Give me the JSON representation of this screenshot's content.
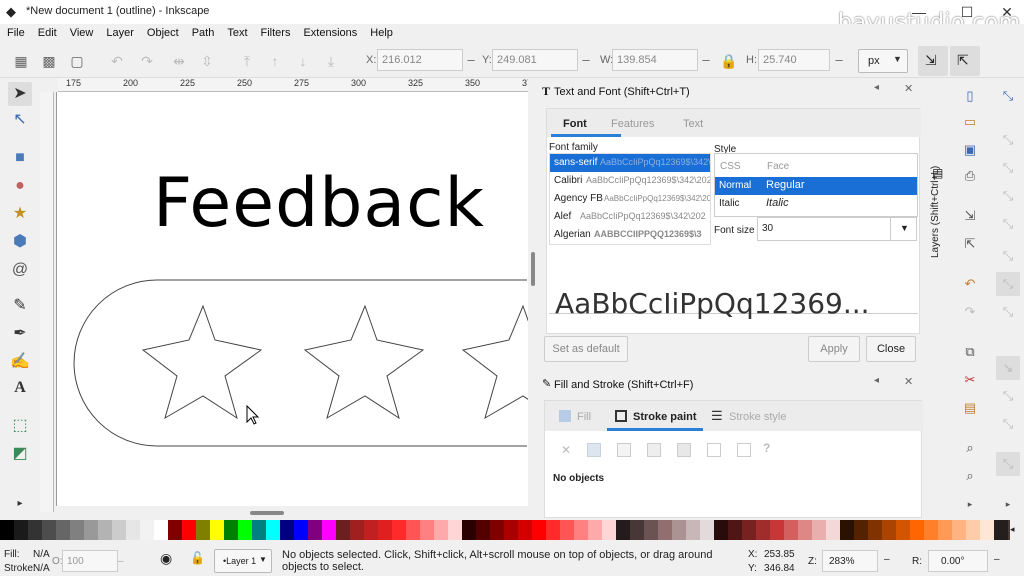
{
  "window": {
    "title": "*New document 1 (outline) - Inkscape"
  },
  "watermark": "bayustudio.com",
  "menu": [
    "File",
    "Edit",
    "View",
    "Layer",
    "Object",
    "Path",
    "Text",
    "Filters",
    "Extensions",
    "Help"
  ],
  "toolbar": {
    "x_label": "X:",
    "x_value": "216.012",
    "y_label": "Y:",
    "y_value": "249.081",
    "w_label": "W:",
    "w_value": "139.854",
    "h_label": "H:",
    "h_value": "25.740",
    "unit": "px"
  },
  "ruler": {
    "top_ticks": [
      "175",
      "200",
      "225",
      "250",
      "275",
      "300",
      "325",
      "350",
      "375",
      "400"
    ]
  },
  "canvas": {
    "text": "Feedback"
  },
  "text_font_panel": {
    "title": "Text and Font (Shift+Ctrl+T)",
    "tabs": [
      "Font",
      "Features",
      "Text"
    ],
    "font_family_label": "Font family",
    "families": [
      {
        "name": "sans-serif",
        "sample": "AaBbCcIiPpQq12369$\\342\\202\\"
      },
      {
        "name": "Calibri",
        "sample": "AaBbCcIiPpQq12369$\\342\\202"
      },
      {
        "name": "Agency FB",
        "sample": "AaBbCcIiPpQq12369$\\342\\202\\25"
      },
      {
        "name": "Alef",
        "sample": "AaBbCcIiPpQq12369$\\342\\202"
      },
      {
        "name": "Algerian",
        "sample": "AABBCCIIPPQQ12369$\\3"
      }
    ],
    "style_label": "Style",
    "style_headers": [
      "CSS",
      "Face"
    ],
    "styles": [
      {
        "css": "Normal",
        "face": "Regular"
      },
      {
        "css": "Italic",
        "face": "Italic"
      }
    ],
    "font_size_label": "Font size",
    "font_size": "30",
    "preview": "AaBbCcIiPpQq12369...",
    "set_default": "Set as default",
    "apply": "Apply",
    "close": "Close"
  },
  "fill_stroke_panel": {
    "title": "Fill and Stroke (Shift+Ctrl+F)",
    "tabs": [
      "Fill",
      "Stroke paint",
      "Stroke style"
    ],
    "no_objects": "No objects"
  },
  "right_panel_label": "Layers (Shift+Ctrl+L)",
  "palette": [
    "#000000",
    "#1a1a1a",
    "#333333",
    "#4d4d4d",
    "#666666",
    "#808080",
    "#999999",
    "#b3b3b3",
    "#cccccc",
    "#e6e6e6",
    "#f2f2f2",
    "#ffffff",
    "#800000",
    "#ff0000",
    "#808000",
    "#ffff00",
    "#008000",
    "#00ff00",
    "#008080",
    "#00ffff",
    "#000080",
    "#0000ff",
    "#800080",
    "#ff00ff",
    "#6b1f1f",
    "#a02020",
    "#c02020",
    "#e02020",
    "#ff2a2a",
    "#ff5555",
    "#ff8080",
    "#ffaaaa",
    "#ffd5d5",
    "#2b0000",
    "#550000",
    "#800000",
    "#aa0000",
    "#d40000",
    "#ff0000",
    "#ff2a2a",
    "#ff5555",
    "#ff8080",
    "#ffaaaa",
    "#ffd5d5",
    "#241c1c",
    "#483737",
    "#6c5353",
    "#916f6f",
    "#ac9393",
    "#c8b7b7",
    "#e3dbdb",
    "#280b0b",
    "#501616",
    "#782121",
    "#a02c2c",
    "#c83737",
    "#d35f5f",
    "#de8787",
    "#e9afaf",
    "#f4d7d7",
    "#2b1100",
    "#552200",
    "#803300",
    "#aa4400",
    "#d45500",
    "#ff6600",
    "#ff7f2a",
    "#ff9955",
    "#ffb380",
    "#ffccaa",
    "#ffe6d5",
    "#241f1c",
    "#483e37",
    "#ff5500"
  ],
  "status": {
    "fill_label": "Fill:",
    "fill_value": "N/A",
    "stroke_label": "Stroke:",
    "stroke_value": "N/A",
    "opacity_label": "O:",
    "opacity_value": "100",
    "layer": "•Layer 1",
    "message": "No objects selected. Click, Shift+click, Alt+scroll mouse on top of objects, or drag around objects to select.",
    "x_label": "X:",
    "x_value": "253.85",
    "y_label": "Y:",
    "y_value": "346.84",
    "zoom_label": "Z:",
    "zoom_value": "283%",
    "rotate_label": "R:",
    "rotate_value": "0.00°"
  }
}
